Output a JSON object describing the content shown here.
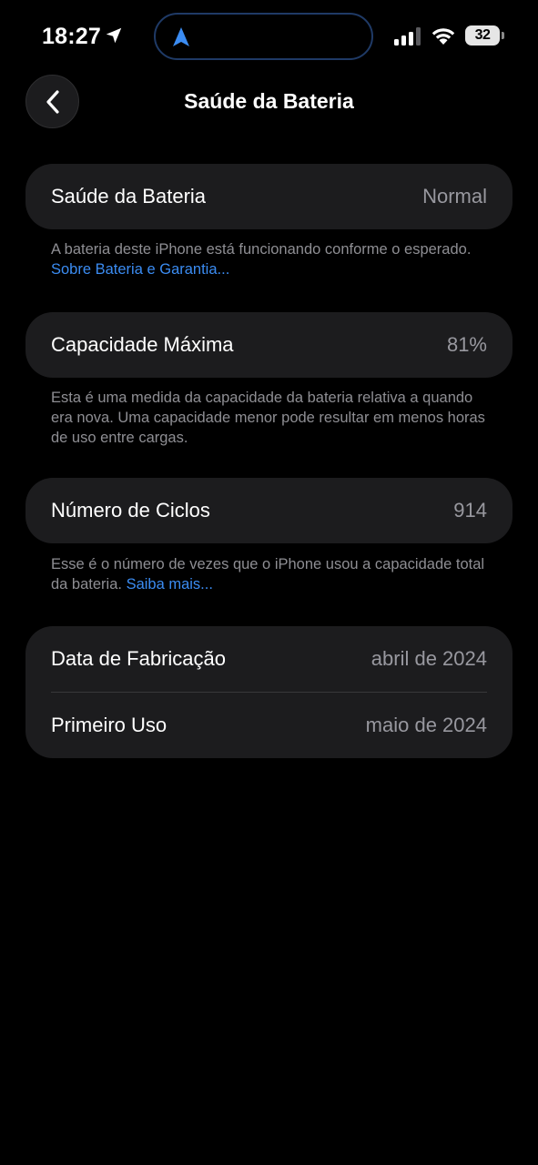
{
  "status_bar": {
    "time": "18:27",
    "battery_level": "32",
    "signal_bars": 3,
    "accent": "#3b8cf2"
  },
  "nav": {
    "back_icon": "chevron-left-icon",
    "title": "Saúde da Bateria"
  },
  "battery_health": {
    "label": "Saúde da Bateria",
    "value": "Normal",
    "footnote": "A bateria deste iPhone está funcionando conforme o esperado. ",
    "footnote_link": "Sobre Bateria e Garantia..."
  },
  "max_capacity": {
    "label": "Capacidade Máxima",
    "value": "81%",
    "footnote": "Esta é uma medida da capacidade da bateria relativa a quando era nova. Uma capacidade menor pode resultar em menos horas de uso entre cargas."
  },
  "cycle_count": {
    "label": "Número de Ciclos",
    "value": "914",
    "footnote": "Esse é o número de vezes que o iPhone usou a capacidade total da bateria. ",
    "footnote_link": "Saiba mais..."
  },
  "dates": {
    "manufacture_label": "Data de Fabricação",
    "manufacture_value": "abril de 2024",
    "first_use_label": "Primeiro Uso",
    "first_use_value": "maio de 2024"
  }
}
